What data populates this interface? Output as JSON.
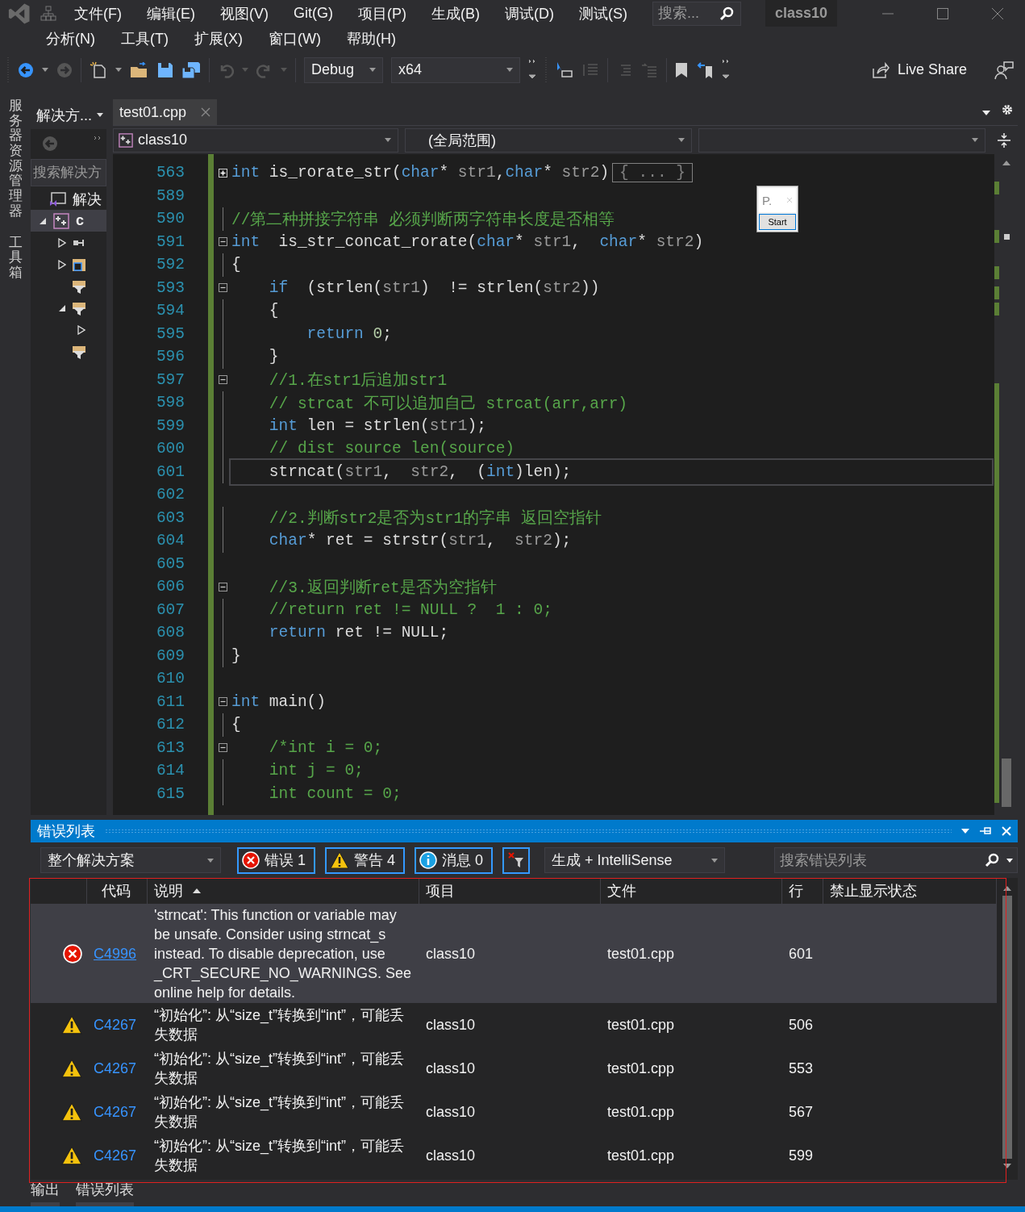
{
  "menu_row_1": [
    "文件(F)",
    "编辑(E)",
    "视图(V)",
    "Git(G)",
    "项目(P)",
    "生成(B)",
    "调试(D)",
    "测试(S)"
  ],
  "search": {
    "placeholder": "搜索..."
  },
  "window_title": "class10",
  "menu_row_2": [
    "分析(N)",
    "工具(T)",
    "扩展(X)",
    "窗口(W)",
    "帮助(H)"
  ],
  "toolbar": {
    "configuration": "Debug",
    "platform": "x64",
    "live_share": "Live Share"
  },
  "side_tabs": [
    "服务器资源管理器",
    "工具箱"
  ],
  "solution_explorer": {
    "title": "解决方...",
    "search": {
      "placeholder": "搜索解决方"
    },
    "tree": [
      {
        "label": "解决",
        "kind": "solution",
        "selected": false,
        "children": [
          {
            "label": "c",
            "kind": "project",
            "expanded": true,
            "selected": true,
            "children": [
              {
                "kind": "references",
                "expanded": false,
                "selected": false
              },
              {
                "kind": "external",
                "expanded": false,
                "selected": false
              },
              {
                "kind": "filter",
                "selected": false
              },
              {
                "kind": "filter",
                "expanded": true,
                "selected": false,
                "children": [
                  {
                    "expanded": false,
                    "selected": false
                  }
                ]
              },
              {
                "kind": "filter",
                "selected": false
              }
            ]
          }
        ]
      }
    ]
  },
  "editor": {
    "tab": "test01.cpp",
    "nav": [
      "class10",
      "(全局范围)"
    ],
    "popup": {
      "title": "P.",
      "button": "Start"
    },
    "lines": [
      {
        "number": "563",
        "collapsed": true,
        "current": false,
        "tokens": [
          {
            "kind": "keyword",
            "text": "int"
          },
          {
            "kind": "text",
            "text": " is_rorate_str("
          },
          {
            "kind": "keyword",
            "text": "char"
          },
          {
            "kind": "text",
            "text": "* "
          },
          {
            "kind": "param",
            "text": "str1"
          },
          {
            "kind": "text",
            "text": ","
          },
          {
            "kind": "keyword",
            "text": "char"
          },
          {
            "kind": "text",
            "text": "* "
          },
          {
            "kind": "param",
            "text": "str2"
          },
          {
            "kind": "text",
            "text": ")"
          },
          {
            "kind": "collapsed",
            "text": "{ ... }"
          }
        ]
      },
      {
        "number": "589",
        "current": false
      },
      {
        "number": "590",
        "current": false,
        "tokens": [
          {
            "kind": "comment",
            "text": "//第二种拼接字符串 必须判断两字符串长度是否相等"
          }
        ]
      },
      {
        "number": "591",
        "collapsed": false,
        "current": false,
        "tokens": [
          {
            "kind": "keyword",
            "text": "int"
          },
          {
            "kind": "text",
            "text": "  is_str_concat_rorate("
          },
          {
            "kind": "keyword",
            "text": "char"
          },
          {
            "kind": "text",
            "text": "* "
          },
          {
            "kind": "param",
            "text": "str1"
          },
          {
            "kind": "text",
            "text": ",  "
          },
          {
            "kind": "keyword",
            "text": "char"
          },
          {
            "kind": "text",
            "text": "* "
          },
          {
            "kind": "param",
            "text": "str2"
          },
          {
            "kind": "text",
            "text": ")"
          }
        ]
      },
      {
        "number": "592",
        "current": false,
        "tokens": [
          {
            "kind": "text",
            "text": "{"
          }
        ]
      },
      {
        "number": "593",
        "collapsed": false,
        "current": false,
        "tokens": [
          {
            "kind": "keyword",
            "text": "    if"
          },
          {
            "kind": "text",
            "text": "  (strlen("
          },
          {
            "kind": "param",
            "text": "str1"
          },
          {
            "kind": "text",
            "text": ")  != strlen("
          },
          {
            "kind": "param",
            "text": "str2"
          },
          {
            "kind": "text",
            "text": "))"
          }
        ]
      },
      {
        "number": "594",
        "current": false,
        "tokens": [
          {
            "kind": "text",
            "text": "    {"
          }
        ]
      },
      {
        "number": "595",
        "current": false,
        "tokens": [
          {
            "kind": "keyword",
            "text": "        return "
          },
          {
            "kind": "number",
            "text": "0"
          },
          {
            "kind": "text",
            "text": ";"
          }
        ]
      },
      {
        "number": "596",
        "current": false,
        "tokens": [
          {
            "kind": "text",
            "text": "    }"
          }
        ]
      },
      {
        "number": "597",
        "collapsed": false,
        "current": false,
        "tokens": [
          {
            "kind": "comment",
            "text": "    //1.在str1后追加str1"
          }
        ]
      },
      {
        "number": "598",
        "current": false,
        "tokens": [
          {
            "kind": "comment",
            "text": "    // strcat 不可以追加自己 strcat(arr,arr)"
          }
        ]
      },
      {
        "number": "599",
        "current": false,
        "tokens": [
          {
            "kind": "keyword",
            "text": "    int"
          },
          {
            "kind": "text",
            "text": " len = strlen("
          },
          {
            "kind": "param",
            "text": "str1"
          },
          {
            "kind": "text",
            "text": ");"
          }
        ]
      },
      {
        "number": "600",
        "current": false,
        "tokens": [
          {
            "kind": "comment",
            "text": "    // dist source len(source)"
          }
        ]
      },
      {
        "number": "601",
        "current": true,
        "tokens": [
          {
            "kind": "text",
            "text": "    strncat("
          },
          {
            "kind": "param",
            "text": "str1"
          },
          {
            "kind": "text",
            "text": ",  "
          },
          {
            "kind": "param",
            "text": "str2"
          },
          {
            "kind": "text",
            "text": ",  ("
          },
          {
            "kind": "keyword",
            "text": "int"
          },
          {
            "kind": "text",
            "text": ")len);"
          }
        ]
      },
      {
        "number": "602",
        "current": false
      },
      {
        "number": "603",
        "current": false,
        "tokens": [
          {
            "kind": "comment",
            "text": "    //2.判断str2是否为str1的字串 返回空指针"
          }
        ]
      },
      {
        "number": "604",
        "current": false,
        "tokens": [
          {
            "kind": "keyword",
            "text": "    char"
          },
          {
            "kind": "text",
            "text": "* ret = strstr("
          },
          {
            "kind": "param",
            "text": "str1"
          },
          {
            "kind": "text",
            "text": ",  "
          },
          {
            "kind": "param",
            "text": "str2"
          },
          {
            "kind": "text",
            "text": ");"
          }
        ]
      },
      {
        "number": "605",
        "current": false
      },
      {
        "number": "606",
        "collapsed": false,
        "current": false,
        "tokens": [
          {
            "kind": "comment",
            "text": "    //3.返回判断ret是否为空指针"
          }
        ]
      },
      {
        "number": "607",
        "current": false,
        "tokens": [
          {
            "kind": "comment",
            "text": "    //return ret != NULL ?  1 : 0;"
          }
        ]
      },
      {
        "number": "608",
        "current": false,
        "tokens": [
          {
            "kind": "keyword",
            "text": "    return"
          },
          {
            "kind": "text",
            "text": " ret != NULL;"
          }
        ]
      },
      {
        "number": "609",
        "current": false,
        "tokens": [
          {
            "kind": "text",
            "text": "}"
          }
        ]
      },
      {
        "number": "610",
        "current": false
      },
      {
        "number": "611",
        "collapsed": false,
        "current": false,
        "tokens": [
          {
            "kind": "keyword",
            "text": "int"
          },
          {
            "kind": "text",
            "text": " main()"
          }
        ]
      },
      {
        "number": "612",
        "current": false,
        "tokens": [
          {
            "kind": "text",
            "text": "{"
          }
        ]
      },
      {
        "number": "613",
        "collapsed": false,
        "current": false,
        "tokens": [
          {
            "kind": "comment",
            "text": "    /*int i = 0;"
          }
        ]
      },
      {
        "number": "614",
        "current": false,
        "tokens": [
          {
            "kind": "comment",
            "text": "    int j = 0;"
          }
        ]
      },
      {
        "number": "615",
        "current": false,
        "tokens": [
          {
            "kind": "comment",
            "text": "    int count = 0;"
          }
        ]
      }
    ]
  },
  "error_list": {
    "title": "错误列表",
    "scope": "整个解决方案",
    "filters": [
      {
        "kind": "error",
        "label": "错误 1",
        "selected": true
      },
      {
        "kind": "warning",
        "label": "警告 4",
        "selected": true
      },
      {
        "kind": "message",
        "label": "消息 0",
        "selected": true
      }
    ],
    "source": "生成 + IntelliSense",
    "search": {
      "placeholder": "搜索错误列表"
    },
    "columns": [
      {
        "label": "代码",
        "sorted": false
      },
      {
        "label": "说明",
        "sorted": true
      },
      {
        "label": "项目",
        "sorted": false
      },
      {
        "label": "文件",
        "sorted": false
      },
      {
        "label": "行",
        "sorted": false
      },
      {
        "label": "禁止显示状态",
        "sorted": false
      }
    ],
    "rows": [
      {
        "kind": "error",
        "code": "C4996",
        "description": "'strncat': This function or variable may be unsafe. Consider using strncat_s instead. To disable deprecation, use _CRT_SECURE_NO_WARNINGS. See online help for details.",
        "project": "class10",
        "file": "test01.cpp",
        "line": "601",
        "selected": true
      },
      {
        "kind": "warning",
        "code": "C4267",
        "description": "“初始化”: 从“size_t”转换到“int”，可能丢失数据",
        "project": "class10",
        "file": "test01.cpp",
        "line": "506",
        "selected": false
      },
      {
        "kind": "warning",
        "code": "C4267",
        "description": "“初始化”: 从“size_t”转换到“int”，可能丢失数据",
        "project": "class10",
        "file": "test01.cpp",
        "line": "553",
        "selected": false
      },
      {
        "kind": "warning",
        "code": "C4267",
        "description": "“初始化”: 从“size_t”转换到“int”，可能丢失数据",
        "project": "class10",
        "file": "test01.cpp",
        "line": "567",
        "selected": false
      },
      {
        "kind": "warning",
        "code": "C4267",
        "description": "“初始化”: 从“size_t”转换到“int”，可能丢失数据",
        "project": "class10",
        "file": "test01.cpp",
        "line": "599",
        "selected": false
      }
    ]
  },
  "bottom_tabs": [
    "输出",
    "错误列表"
  ]
}
